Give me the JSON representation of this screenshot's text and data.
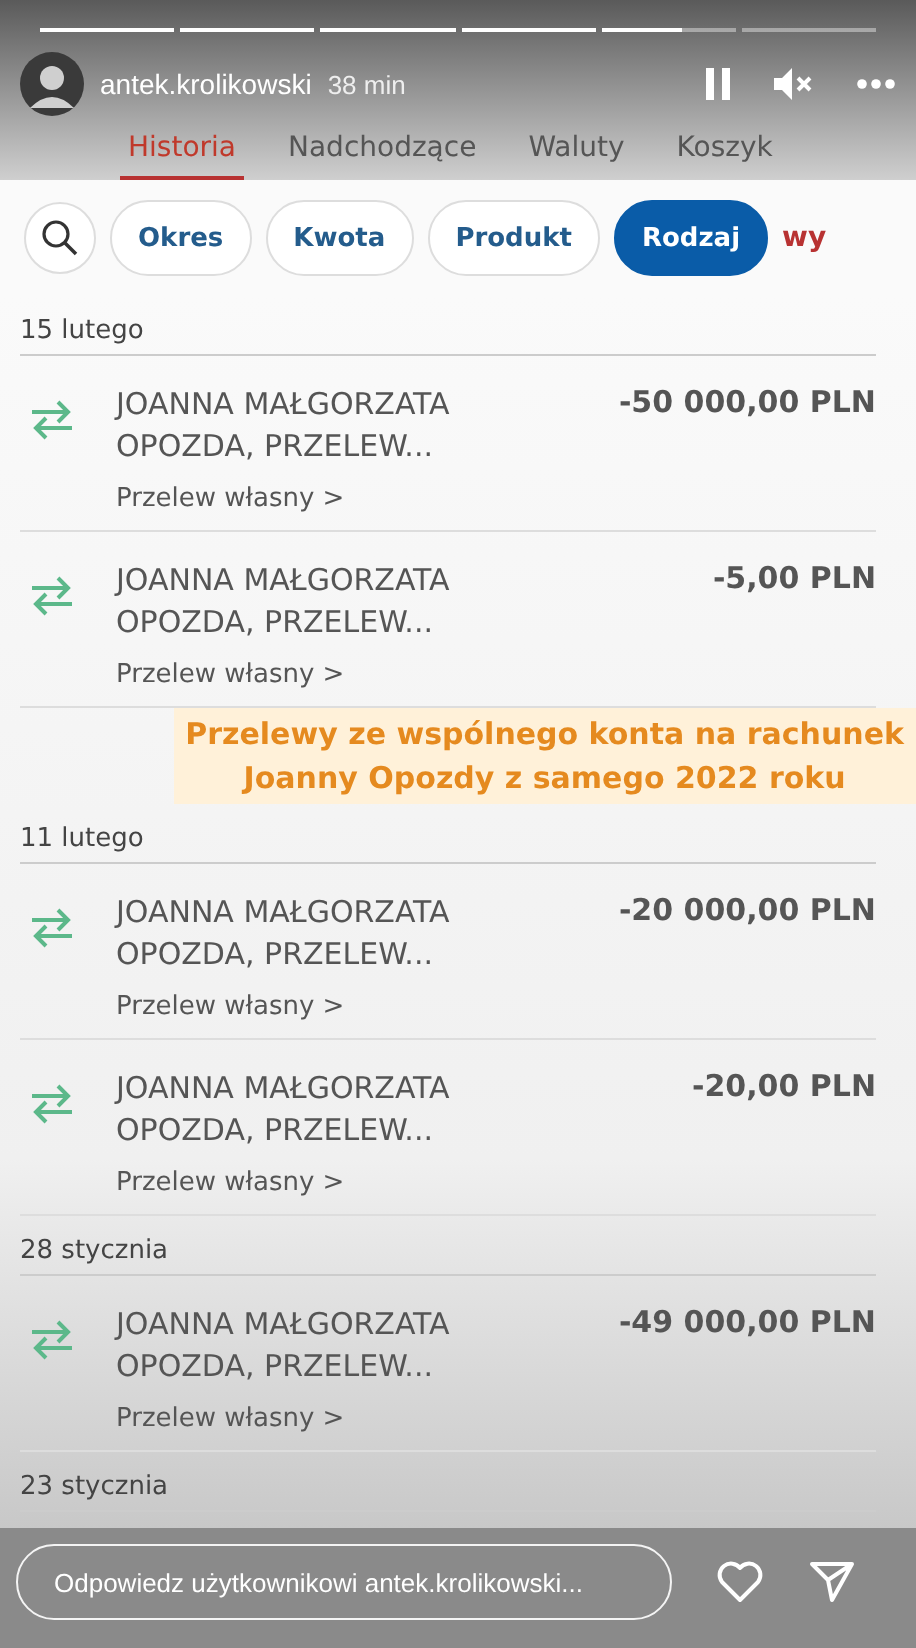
{
  "story": {
    "progress": [
      {
        "level": 1
      },
      {
        "level": 1
      },
      {
        "level": 1
      },
      {
        "level": 1
      },
      {
        "level": 0.6
      },
      {
        "level": 0
      }
    ],
    "user": "antek.krolikowski",
    "time": "38 min",
    "paused": false,
    "muted": true
  },
  "tabs": [
    {
      "label": "Historia",
      "selected": true
    },
    {
      "label": "Nadchodzące",
      "selected": false
    },
    {
      "label": "Waluty",
      "selected": false
    },
    {
      "label": "Koszyk",
      "selected": false
    }
  ],
  "filters": [
    {
      "label": "Okres",
      "selected": false
    },
    {
      "label": "Kwota",
      "selected": false
    },
    {
      "label": "Produkt",
      "selected": false
    },
    {
      "label": "Rodzaj",
      "selected": true
    }
  ],
  "clear_link": "wy",
  "groups": [
    {
      "date": "15 lutego",
      "items": [
        {
          "name_lines": [
            "JOANNA MAŁGORZATA",
            "OPOZDA, PRZELEW..."
          ],
          "amount": "-50 000,00 PLN",
          "type": "Przelew własny >"
        },
        {
          "name_lines": [
            "JOANNA MAŁGORZATA",
            "OPOZDA, PRZELEW..."
          ],
          "amount": "-5,00 PLN",
          "type": "Przelew własny >"
        }
      ],
      "caption": [
        "Przelewy ze wspólnego konta na rachunek",
        "Joanny Opozdy z samego 2022 roku"
      ]
    },
    {
      "date": "11 lutego",
      "items": [
        {
          "name_lines": [
            "JOANNA MAŁGORZATA",
            "OPOZDA, PRZELEW..."
          ],
          "amount": "-20 000,00 PLN",
          "type": "Przelew własny >"
        },
        {
          "name_lines": [
            "JOANNA MAŁGORZATA",
            "OPOZDA, PRZELEW..."
          ],
          "amount": "-20,00 PLN",
          "type": "Przelew własny >"
        }
      ]
    },
    {
      "date": "28 stycznia",
      "items": [
        {
          "name_lines": [
            "JOANNA MAŁGORZATA",
            "OPOZDA, PRZELEW..."
          ],
          "amount": "-49 000,00 PLN",
          "type": "Przelew własny >"
        }
      ]
    },
    {
      "date": "23 stycznia"
    }
  ],
  "reply": {
    "placeholder": "Odpowiedz użytkownikowi antek.krolikowski..."
  }
}
